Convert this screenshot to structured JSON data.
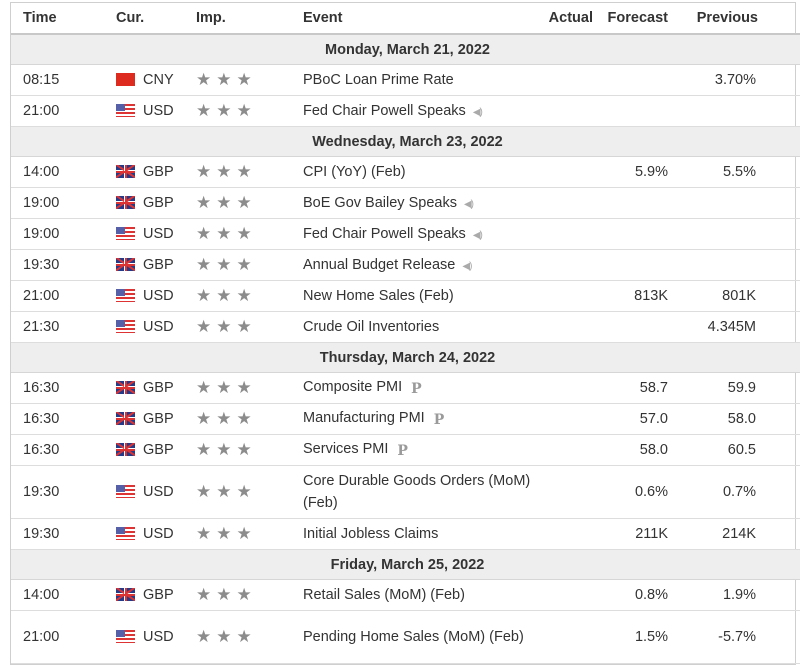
{
  "columns": {
    "time": "Time",
    "currency": "Cur.",
    "importance": "Imp.",
    "event": "Event",
    "actual": "Actual",
    "forecast": "Forecast",
    "previous": "Previous"
  },
  "icons": {
    "star": "★",
    "speaker": "🔈",
    "preliminary": "P"
  },
  "days": [
    {
      "label": "Monday, March 21, 2022",
      "events": [
        {
          "time": "08:15",
          "flag": "cn",
          "currency": "CNY",
          "importance": 3,
          "stars": "★★★",
          "event": "PBoC Loan Prime Rate",
          "tag": "",
          "actual": "",
          "forecast": "",
          "previous": "3.70%"
        },
        {
          "time": "21:00",
          "flag": "us",
          "currency": "USD",
          "importance": 3,
          "stars": "★★★",
          "event": "Fed Chair Powell Speaks",
          "tag": "speech",
          "actual": "",
          "forecast": "",
          "previous": ""
        }
      ]
    },
    {
      "label": "Wednesday, March 23, 2022",
      "events": [
        {
          "time": "14:00",
          "flag": "gb",
          "currency": "GBP",
          "importance": 3,
          "stars": "★★★",
          "event": "CPI (YoY) (Feb)",
          "tag": "",
          "actual": "",
          "forecast": "5.9%",
          "previous": "5.5%"
        },
        {
          "time": "19:00",
          "flag": "gb",
          "currency": "GBP",
          "importance": 3,
          "stars": "★★★",
          "event": "BoE Gov Bailey Speaks",
          "tag": "speech",
          "actual": "",
          "forecast": "",
          "previous": ""
        },
        {
          "time": "19:00",
          "flag": "us",
          "currency": "USD",
          "importance": 3,
          "stars": "★★★",
          "event": "Fed Chair Powell Speaks",
          "tag": "speech",
          "actual": "",
          "forecast": "",
          "previous": ""
        },
        {
          "time": "19:30",
          "flag": "gb",
          "currency": "GBP",
          "importance": 3,
          "stars": "★★★",
          "event": "Annual Budget Release",
          "tag": "speech",
          "actual": "",
          "forecast": "",
          "previous": ""
        },
        {
          "time": "21:00",
          "flag": "us",
          "currency": "USD",
          "importance": 3,
          "stars": "★★★",
          "event": "New Home Sales (Feb)",
          "tag": "",
          "actual": "",
          "forecast": "813K",
          "previous": "801K"
        },
        {
          "time": "21:30",
          "flag": "us",
          "currency": "USD",
          "importance": 3,
          "stars": "★★★",
          "event": "Crude Oil Inventories",
          "tag": "",
          "actual": "",
          "forecast": "",
          "previous": "4.345M"
        }
      ]
    },
    {
      "label": "Thursday, March 24, 2022",
      "events": [
        {
          "time": "16:30",
          "flag": "gb",
          "currency": "GBP",
          "importance": 3,
          "stars": "★★★",
          "event": "Composite PMI",
          "tag": "preliminary",
          "actual": "",
          "forecast": "58.7",
          "previous": "59.9"
        },
        {
          "time": "16:30",
          "flag": "gb",
          "currency": "GBP",
          "importance": 3,
          "stars": "★★★",
          "event": "Manufacturing PMI",
          "tag": "preliminary",
          "actual": "",
          "forecast": "57.0",
          "previous": "58.0"
        },
        {
          "time": "16:30",
          "flag": "gb",
          "currency": "GBP",
          "importance": 3,
          "stars": "★★★",
          "event": "Services PMI",
          "tag": "preliminary",
          "actual": "",
          "forecast": "58.0",
          "previous": "60.5"
        },
        {
          "time": "19:30",
          "flag": "us",
          "currency": "USD",
          "importance": 3,
          "stars": "★★★",
          "event": "Core Durable Goods Orders (MoM) (Feb)",
          "tag": "",
          "actual": "",
          "forecast": "0.6%",
          "previous": "0.7%",
          "tall": true
        },
        {
          "time": "19:30",
          "flag": "us",
          "currency": "USD",
          "importance": 3,
          "stars": "★★★",
          "event": "Initial Jobless Claims",
          "tag": "",
          "actual": "",
          "forecast": "211K",
          "previous": "214K"
        }
      ]
    },
    {
      "label": "Friday, March 25, 2022",
      "events": [
        {
          "time": "14:00",
          "flag": "gb",
          "currency": "GBP",
          "importance": 3,
          "stars": "★★★",
          "event": "Retail Sales (MoM) (Feb)",
          "tag": "",
          "actual": "",
          "forecast": "0.8%",
          "previous": "1.9%"
        },
        {
          "time": "21:00",
          "flag": "us",
          "currency": "USD",
          "importance": 3,
          "stars": "★★★",
          "event": "Pending Home Sales (MoM) (Feb)",
          "tag": "",
          "actual": "",
          "forecast": "1.5%",
          "previous": "-5.7%",
          "tall": true
        }
      ]
    }
  ]
}
